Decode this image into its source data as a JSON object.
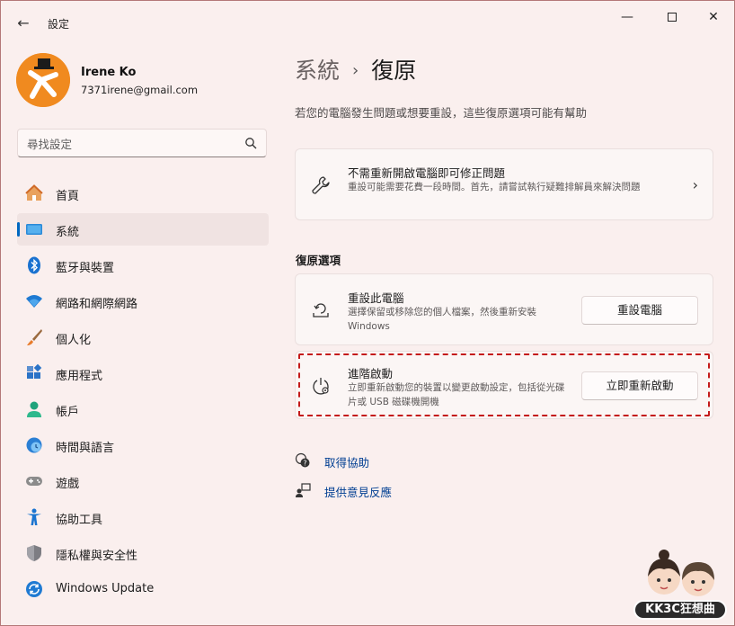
{
  "window": {
    "title": "設定",
    "back_glyph": "←",
    "minimize_glyph": "—",
    "close_glyph": "✕"
  },
  "user": {
    "name": "Irene Ko",
    "email": "7371irene@gmail.com"
  },
  "search": {
    "placeholder": "尋找設定"
  },
  "sidebar": {
    "items": [
      {
        "label": "首頁",
        "icon": "home-icon"
      },
      {
        "label": "系統",
        "icon": "system-icon",
        "active": true
      },
      {
        "label": "藍牙與裝置",
        "icon": "bluetooth-icon"
      },
      {
        "label": "網路和網際網路",
        "icon": "wifi-icon"
      },
      {
        "label": "個人化",
        "icon": "brush-icon"
      },
      {
        "label": "應用程式",
        "icon": "apps-icon"
      },
      {
        "label": "帳戶",
        "icon": "account-icon"
      },
      {
        "label": "時間與語言",
        "icon": "time-language-icon"
      },
      {
        "label": "遊戲",
        "icon": "gamepad-icon"
      },
      {
        "label": "協助工具",
        "icon": "accessibility-icon"
      },
      {
        "label": "隱私權與安全性",
        "icon": "shield-icon"
      },
      {
        "label": "Windows Update",
        "icon": "update-icon"
      }
    ]
  },
  "main": {
    "breadcrumb_parent": "系統",
    "breadcrumb_sep": "›",
    "breadcrumb_current": "復原",
    "subtitle": "若您的電腦發生問題或想要重設，這些復原選項可能有幫助",
    "fix_card": {
      "title": "不需重新開啟電腦即可修正問題",
      "desc": "重設可能需要花費一段時間。首先，請嘗試執行疑難排解員來解決問題",
      "chevron": "›"
    },
    "section_title": "復原選項",
    "reset_card": {
      "title": "重設此電腦",
      "desc": "選擇保留或移除您的個人檔案，然後重新安裝 Windows",
      "button": "重設電腦"
    },
    "advanced_card": {
      "title": "進階啟動",
      "desc": "立即重新啟動您的裝置以變更啟動設定，包括從光碟片或 USB 磁碟機開機",
      "button": "立即重新啟動"
    },
    "links": {
      "help": "取得協助",
      "feedback": "提供意見反應"
    }
  },
  "watermark": {
    "text": "KK3C狂想曲"
  },
  "colors": {
    "accent": "#0067c0",
    "background": "#faefee",
    "highlight_border": "#c41a1a",
    "link": "#003e92"
  }
}
